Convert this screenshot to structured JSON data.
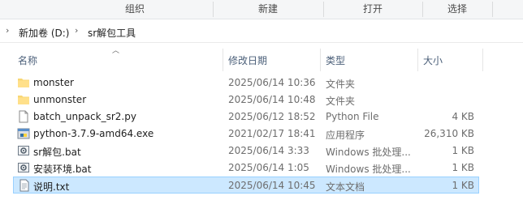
{
  "ribbon": {
    "groups": [
      "组织",
      "新建",
      "打开",
      "选择"
    ]
  },
  "address": {
    "segments": [
      "新加卷 (D:)",
      "sr解包工具"
    ]
  },
  "columns": {
    "name": "名称",
    "modified": "修改日期",
    "type": "类型",
    "size": "大小"
  },
  "files": [
    {
      "name": "monster",
      "modified": "2025/06/14 10:36",
      "type": "文件夹",
      "size": "",
      "icon": "folder-icon"
    },
    {
      "name": "unmonster",
      "modified": "2025/06/14 10:48",
      "type": "文件夹",
      "size": "",
      "icon": "folder-icon"
    },
    {
      "name": "batch_unpack_sr2.py",
      "modified": "2025/06/12 18:52",
      "type": "Python File",
      "size": "4 KB",
      "icon": "document-icon"
    },
    {
      "name": "python-3.7.9-amd64.exe",
      "modified": "2021/02/17 18:41",
      "type": "应用程序",
      "size": "26,310 KB",
      "icon": "installer-icon"
    },
    {
      "name": "sr解包.bat",
      "modified": "2025/06/14 3:33",
      "type": "Windows 批处理...",
      "size": "1 KB",
      "icon": "batch-file-icon"
    },
    {
      "name": "安装环境.bat",
      "modified": "2025/06/14 1:05",
      "type": "Windows 批处理...",
      "size": "1 KB",
      "icon": "batch-file-icon"
    },
    {
      "name": "说明.txt",
      "modified": "2025/06/14 10:45",
      "type": "文本文档",
      "size": "1 KB",
      "icon": "text-file-icon",
      "selected": true
    }
  ],
  "colors": {
    "selection_bg": "#cce8ff",
    "selection_border": "#99d1ff",
    "folder": "#f8d775",
    "header_text": "#4c607a"
  }
}
